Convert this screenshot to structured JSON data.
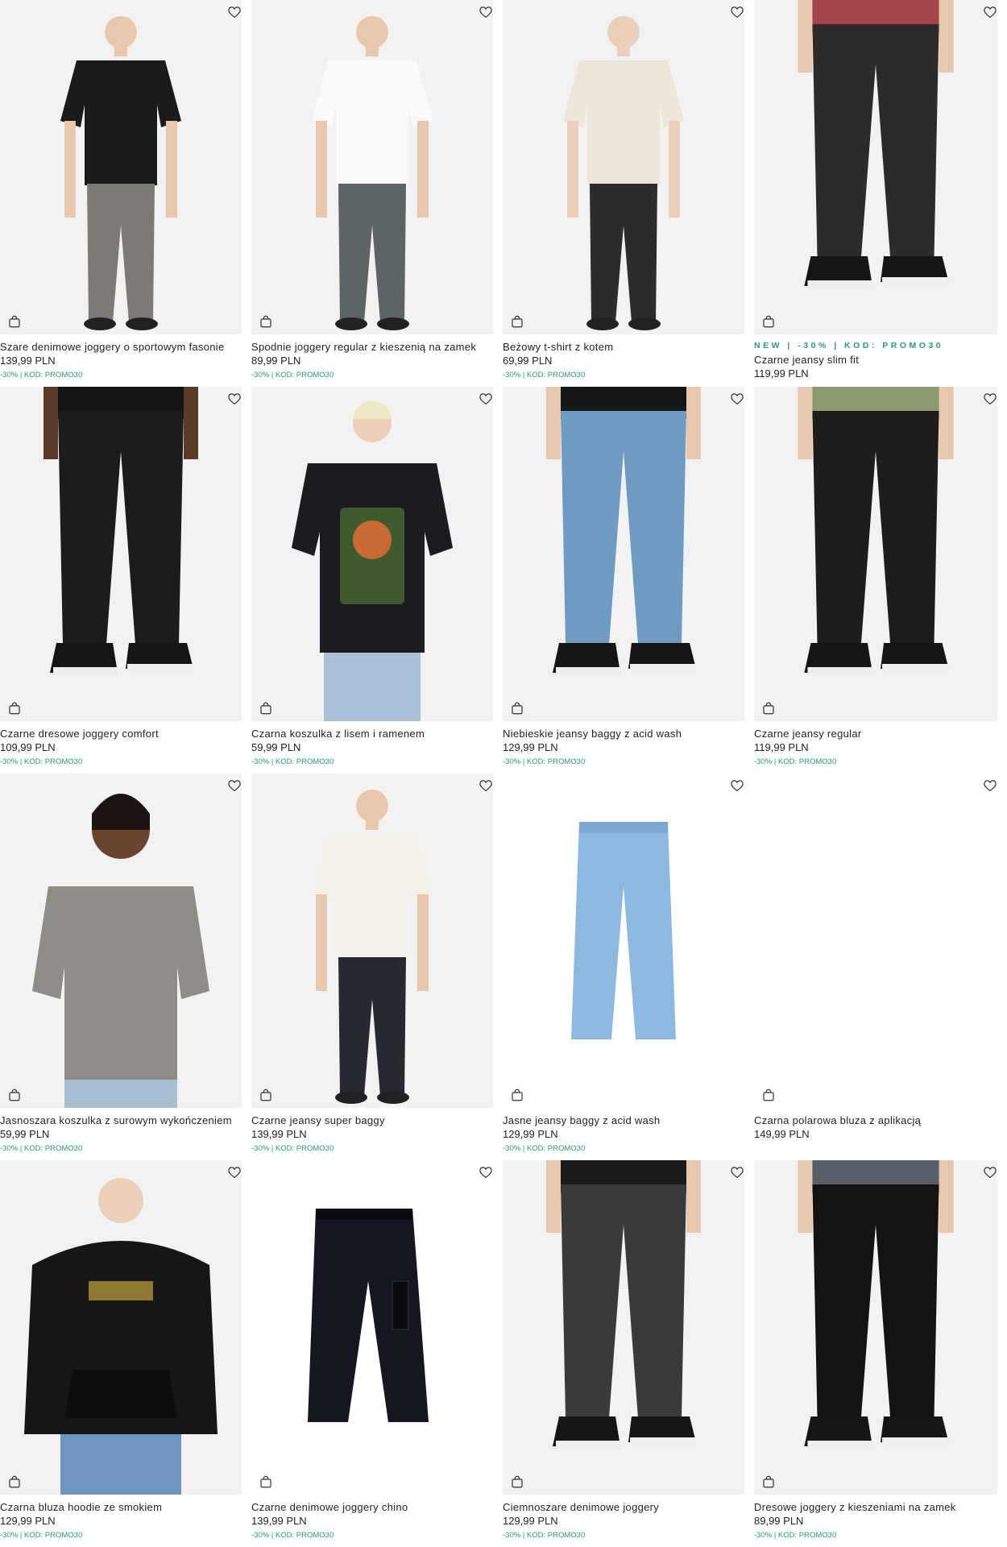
{
  "products": [
    {
      "name": "Szare denimowe joggery o sportowym fasonie",
      "price": "139,99 PLN",
      "promo": "-30% | KOD: PROMO30",
      "promo_top": "",
      "bg": "#f2f2f2",
      "top": "#1b1b1b",
      "bottom": "#7d7a75",
      "skin": "#e8c7ad",
      "kind": "model"
    },
    {
      "name": "Spodnie joggery regular z kieszenią na zamek",
      "price": "89,99 PLN",
      "promo": "-30% | KOD: PROMO30",
      "promo_top": "",
      "bg": "#f2f2f2",
      "top": "#fafafa",
      "bottom": "#5c6468",
      "skin": "#e8c7ad",
      "kind": "model"
    },
    {
      "name": "Beżowy t-shirt z kotem",
      "price": "69,99 PLN",
      "promo": "-30% | KOD: PROMO30",
      "promo_top": "",
      "bg": "#f2f2f2",
      "top": "#eee6d8",
      "bottom": "#2c2c2c",
      "skin": "#ead0ba",
      "kind": "model"
    },
    {
      "name": "Czarne jeansy slim fit",
      "price": "119,99 PLN",
      "promo": "",
      "promo_top": "NEW | -30% | KOD: PROMO30",
      "bg": "#f2f2f2",
      "top": "#a3454a",
      "bottom": "#2b2b2b",
      "skin": "#e8c7ad",
      "kind": "legs"
    },
    {
      "name": "Czarne dresowe joggery comfort",
      "price": "109,99 PLN",
      "promo": "-30% | KOD: PROMO30",
      "promo_top": "",
      "bg": "#f2f2f2",
      "top": "#141414",
      "bottom": "#1c1c1c",
      "skin": "#5a3b2a",
      "kind": "legs"
    },
    {
      "name": "Czarna koszulka z lisem i ramenem",
      "price": "59,99 PLN",
      "promo": "-30% | KOD: PROMO30",
      "promo_top": "",
      "bg": "#f2f2f2",
      "top": "#1a1c22",
      "bottom": "#a9c0d6",
      "skin": "#ead0ba",
      "kind": "back"
    },
    {
      "name": "Niebieskie jeansy baggy z acid wash",
      "price": "129,99 PLN",
      "promo": "-30% | KOD: PROMO30",
      "promo_top": "",
      "bg": "#f2f2f2",
      "top": "#161616",
      "bottom": "#6f9bc2",
      "skin": "#e8c7ad",
      "kind": "legs"
    },
    {
      "name": "Czarne jeansy regular",
      "price": "119,99 PLN",
      "promo": "-30% | KOD: PROMO30",
      "promo_top": "",
      "bg": "#f2f2f2",
      "top": "#8a9a6a",
      "bottom": "#1d1d1d",
      "skin": "#e8c7ad",
      "kind": "legs"
    },
    {
      "name": "Jasnoszara koszulka z surowym wykończeniem",
      "price": "59,99 PLN",
      "promo": "-30% | KOD: PROMO30",
      "promo_top": "",
      "bg": "#f2f2f2",
      "top": "#8f8c88",
      "bottom": "#a7bdd0",
      "skin": "#6b4430",
      "kind": "bust"
    },
    {
      "name": "Czarne jeansy super baggy",
      "price": "139,99 PLN",
      "promo": "-30% | KOD: PROMO30",
      "promo_top": "",
      "bg": "#f2f2f2",
      "top": "#f4f1e8",
      "bottom": "#262a30",
      "skin": "#e8c7ad",
      "kind": "model"
    },
    {
      "name": "Jasne jeansy baggy z acid wash",
      "price": "129,99 PLN",
      "promo": "-30% | KOD: PROMO30",
      "promo_top": "",
      "bg": "#ffffff",
      "top": "#ffffff",
      "bottom": "#8db9de",
      "skin": "#ffffff",
      "kind": "flatjeans"
    },
    {
      "name": "Czarna polarowa bluza z aplikacją",
      "price": "149,99 PLN",
      "promo": "",
      "promo_top": "",
      "bg": "#ffffff",
      "top": "#ffffff",
      "bottom": "#ffffff",
      "skin": "#ffffff",
      "kind": "empty"
    },
    {
      "name": "Czarna bluza hoodie ze smokiem",
      "price": "129,99 PLN",
      "promo": "-30% | KOD: PROMO30",
      "promo_top": "",
      "bg": "#f2f2f2",
      "top": "#161616",
      "bottom": "#6f94bd",
      "skin": "#ead0ba",
      "kind": "hoodie"
    },
    {
      "name": "Czarne denimowe joggery chino",
      "price": "139,99 PLN",
      "promo": "-30% | KOD: PROMO30",
      "promo_top": "",
      "bg": "#ffffff",
      "top": "#ffffff",
      "bottom": "#141620",
      "skin": "#ffffff",
      "kind": "flatjogger"
    },
    {
      "name": "Ciemnoszare denimowe joggery",
      "price": "129,99 PLN",
      "promo": "-30% | KOD: PROMO30",
      "promo_top": "",
      "bg": "#f2f2f2",
      "top": "#1a1a1a",
      "bottom": "#3a3a3a",
      "skin": "#e8c7ad",
      "kind": "legs"
    },
    {
      "name": "Dresowe joggery z kieszeniami na zamek",
      "price": "89,99 PLN",
      "promo": "-30% | KOD: PROMO30",
      "promo_top": "",
      "bg": "#f2f2f2",
      "top": "#585e6a",
      "bottom": "#131313",
      "skin": "#e8c7ad",
      "kind": "legs"
    }
  ]
}
